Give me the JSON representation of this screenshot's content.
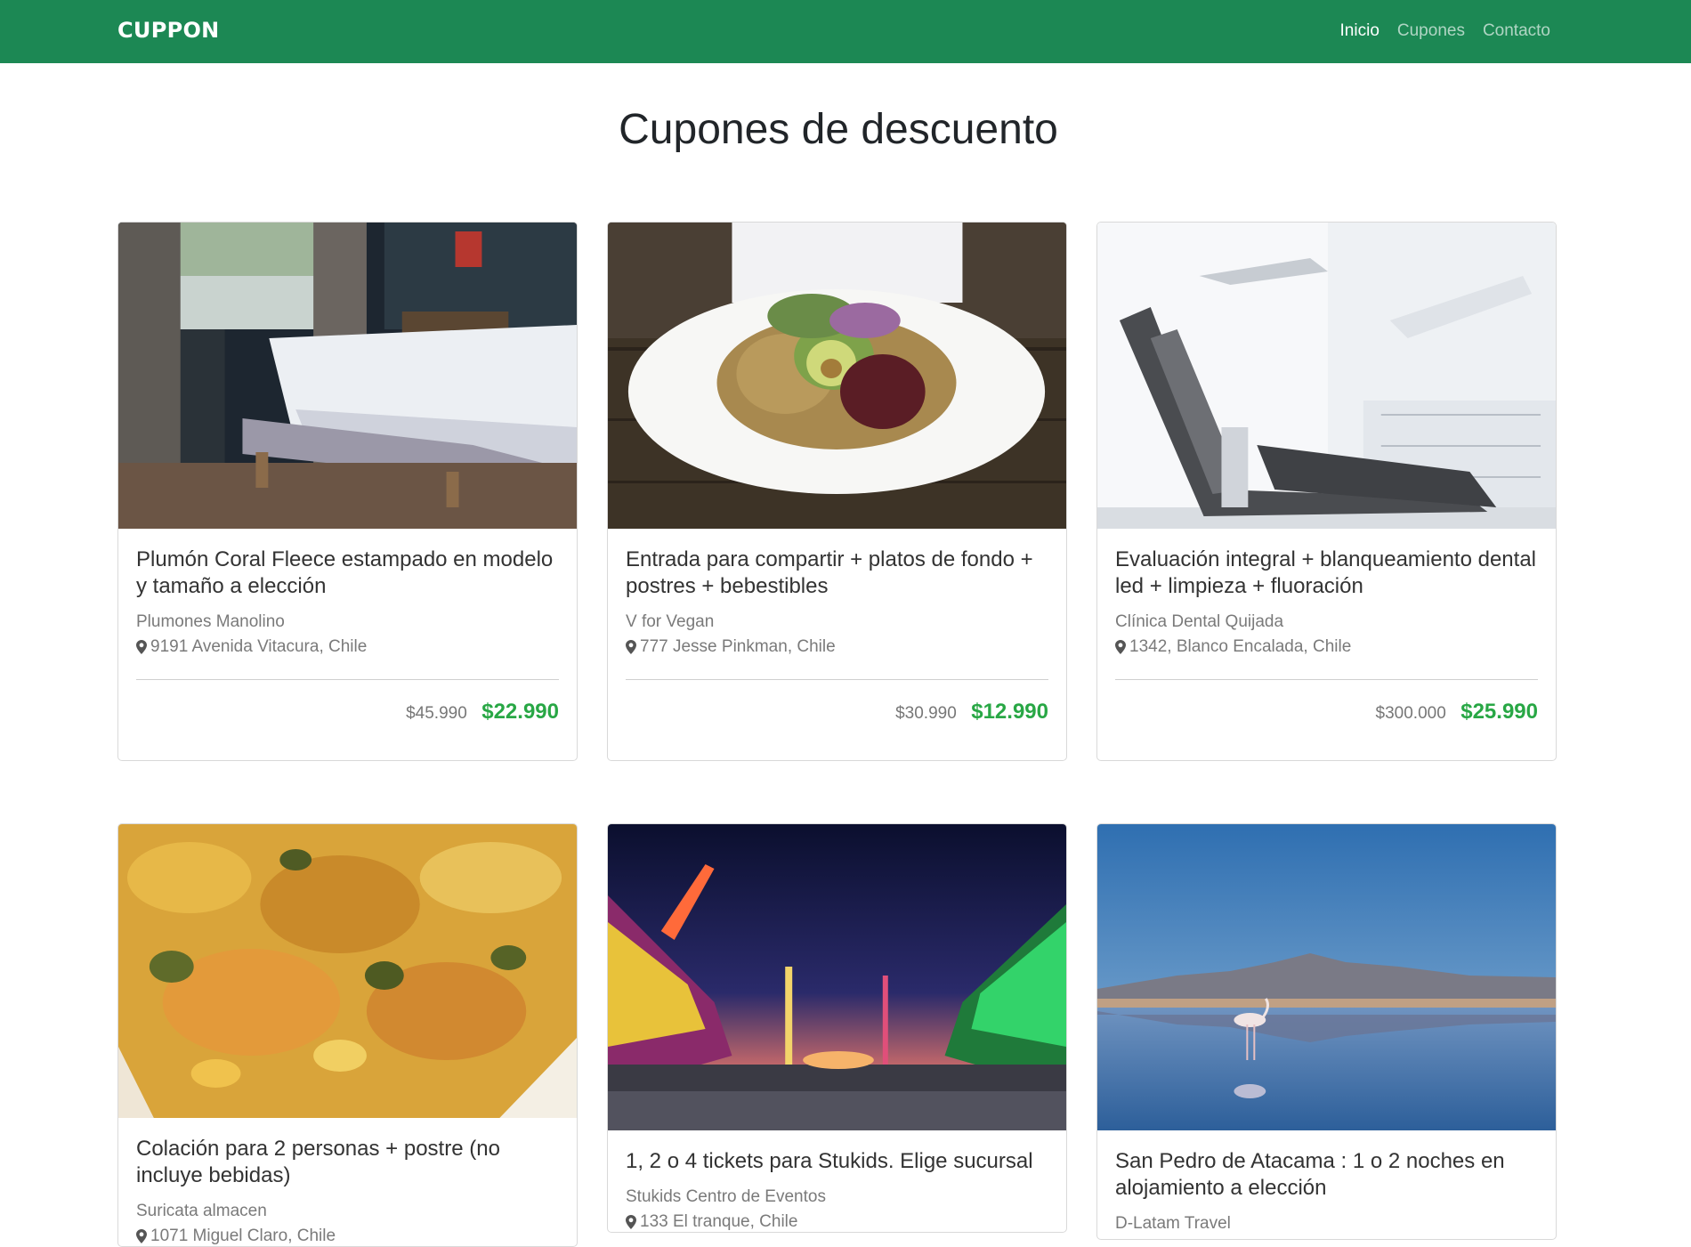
{
  "nav": {
    "brand": "CUPPON",
    "links": [
      {
        "label": "Inicio"
      },
      {
        "label": "Cupones"
      },
      {
        "label": "Contacto"
      }
    ]
  },
  "page_title": "Cupones de descuento",
  "cards": [
    {
      "title": "Plumón Coral Fleece estampado en modelo y tamaño a elección",
      "merchant": "Plumones Manolino",
      "location": "9191 Avenida Vitacura, Chile",
      "old_price": "$45.990",
      "new_price": "$22.990"
    },
    {
      "title": "Entrada para compartir + platos de fondo + postres + bebestibles",
      "merchant": "V for Vegan",
      "location": "777 Jesse Pinkman, Chile",
      "old_price": "$30.990",
      "new_price": "$12.990"
    },
    {
      "title": "Evaluación integral + blanqueamiento dental led + limpieza + fluoración",
      "merchant": "Clínica Dental Quijada",
      "location": "1342, Blanco Encalada, Chile",
      "old_price": "$300.000",
      "new_price": "$25.990"
    },
    {
      "title": "Colación para 2 personas + postre (no incluye bebidas)",
      "merchant": "Suricata almacen",
      "location": "1071 Miguel Claro, Chile"
    },
    {
      "title": "1, 2 o 4 tickets para Stukids. Elige sucursal",
      "merchant": "Stukids Centro de Eventos",
      "location": "133 El tranque, Chile"
    },
    {
      "title": "San Pedro de Atacama : 1 o 2 noches en alojamiento a elección",
      "merchant": "D-Latam Travel"
    }
  ]
}
